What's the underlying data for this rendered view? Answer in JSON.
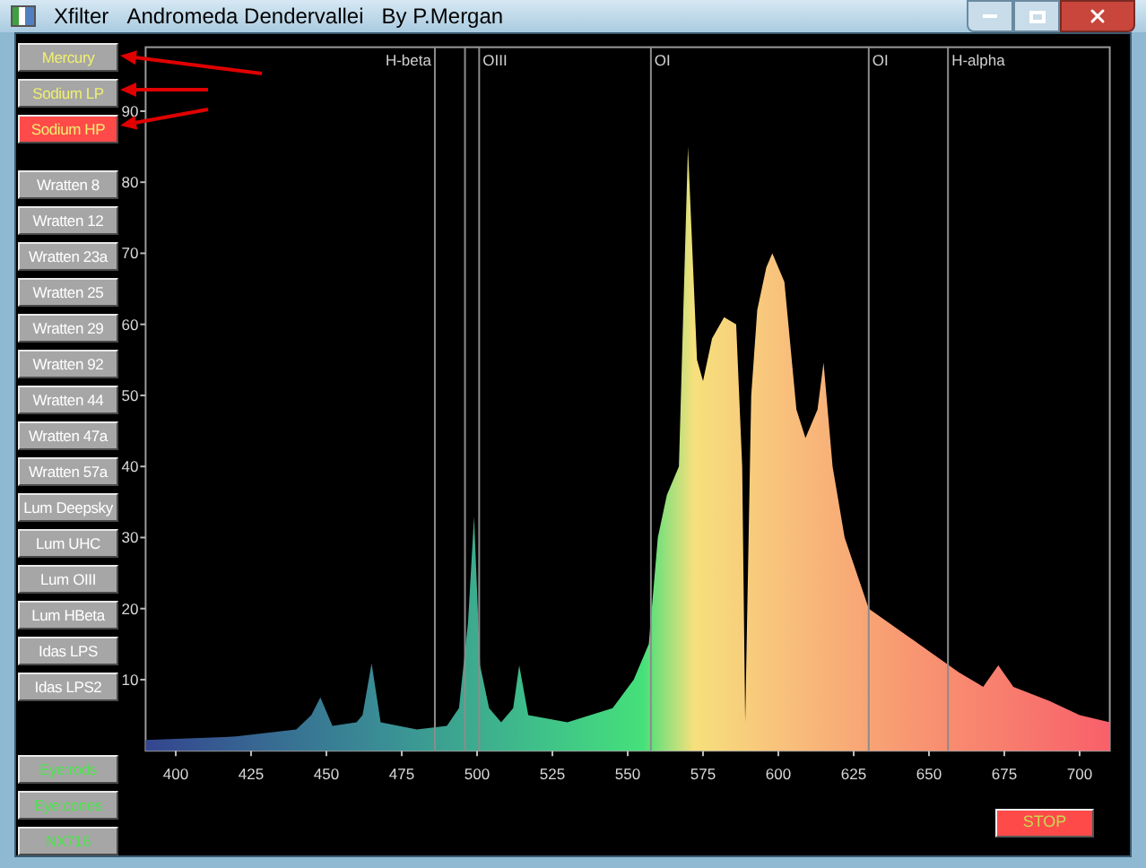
{
  "window": {
    "title_parts": [
      "Xfilter",
      "Andromeda Dendervallei",
      "By P.Mergan"
    ]
  },
  "lamp_buttons": [
    {
      "label": "Mercury",
      "selected": false
    },
    {
      "label": "Sodium LP",
      "selected": false
    },
    {
      "label": "Sodium HP",
      "selected": true
    }
  ],
  "filter_buttons": [
    "Wratten 8",
    "Wratten 12",
    "Wratten 23a",
    "Wratten 25",
    "Wratten 29",
    "Wratten 92",
    "Wratten 44",
    "Wratten 47a",
    "Wratten 57a",
    "Lum Deepsky",
    "Lum UHC",
    "Lum OIII",
    "Lum HBeta",
    "Idas LPS",
    "Idas LPS2"
  ],
  "sensor_buttons": [
    "Eye:rods",
    "Eye:cones",
    "NX716"
  ],
  "spectrum": {
    "chart_data": {
      "type": "area",
      "xlim": [
        390,
        710
      ],
      "ylim": [
        0,
        99
      ],
      "xticks": [
        400,
        425,
        450,
        475,
        500,
        525,
        550,
        575,
        600,
        625,
        650,
        675,
        700
      ],
      "yticks": [
        10,
        20,
        30,
        40,
        50,
        60,
        70,
        80,
        90
      ],
      "x": [
        390,
        420,
        440,
        445,
        448,
        452,
        460,
        462,
        465,
        468,
        480,
        490,
        494,
        497,
        499,
        501,
        504,
        508,
        512,
        514,
        517,
        530,
        545,
        552,
        557,
        560,
        563,
        567,
        570,
        573,
        575,
        578,
        582,
        586,
        588,
        589,
        591,
        593,
        596,
        598,
        602,
        606,
        609,
        613,
        615,
        618,
        622,
        630,
        640,
        650,
        660,
        668,
        673,
        678,
        690,
        700,
        710
      ],
      "series": [
        {
          "color": "#f8606a",
          "values": [
            1.5,
            2,
            3,
            5,
            7.5,
            3.5,
            4,
            5,
            12.3,
            4,
            3,
            3.5,
            6,
            18,
            33,
            12,
            6,
            4,
            6,
            12,
            5,
            4,
            6,
            10,
            15,
            30,
            36,
            40,
            85,
            55,
            52,
            58,
            61,
            60,
            40,
            4,
            50,
            62,
            68,
            70,
            66,
            48,
            44,
            48,
            54.6,
            40,
            30,
            20,
            17,
            14,
            11,
            9,
            12,
            9,
            7,
            5,
            4
          ]
        }
      ],
      "ref_lines": [
        {
          "axis": "x",
          "value": 486,
          "label": "H-beta"
        },
        {
          "axis": "x",
          "value": 496
        },
        {
          "axis": "x",
          "value": 500.7,
          "label": "OIII"
        },
        {
          "axis": "x",
          "value": 557.7,
          "label": "OI"
        },
        {
          "axis": "x",
          "value": 630,
          "label": "OI"
        },
        {
          "axis": "x",
          "value": 656.3,
          "label": "H-alpha"
        }
      ]
    }
  },
  "stop_button": {
    "label": "STOP"
  }
}
